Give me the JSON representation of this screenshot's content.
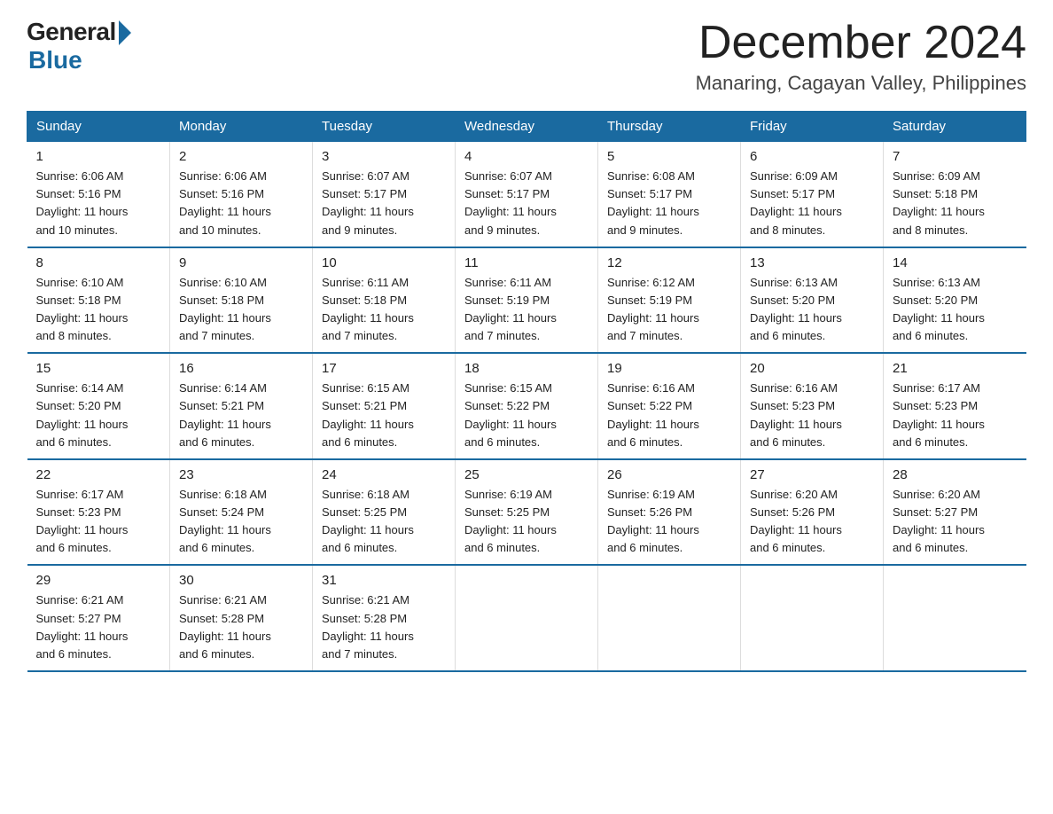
{
  "logo": {
    "general": "General",
    "blue": "Blue"
  },
  "header": {
    "month": "December 2024",
    "location": "Manaring, Cagayan Valley, Philippines"
  },
  "days_of_week": [
    "Sunday",
    "Monday",
    "Tuesday",
    "Wednesday",
    "Thursday",
    "Friday",
    "Saturday"
  ],
  "weeks": [
    [
      {
        "day": "1",
        "sunrise": "6:06 AM",
        "sunset": "5:16 PM",
        "daylight": "11 hours and 10 minutes."
      },
      {
        "day": "2",
        "sunrise": "6:06 AM",
        "sunset": "5:16 PM",
        "daylight": "11 hours and 10 minutes."
      },
      {
        "day": "3",
        "sunrise": "6:07 AM",
        "sunset": "5:17 PM",
        "daylight": "11 hours and 9 minutes."
      },
      {
        "day": "4",
        "sunrise": "6:07 AM",
        "sunset": "5:17 PM",
        "daylight": "11 hours and 9 minutes."
      },
      {
        "day": "5",
        "sunrise": "6:08 AM",
        "sunset": "5:17 PM",
        "daylight": "11 hours and 9 minutes."
      },
      {
        "day": "6",
        "sunrise": "6:09 AM",
        "sunset": "5:17 PM",
        "daylight": "11 hours and 8 minutes."
      },
      {
        "day": "7",
        "sunrise": "6:09 AM",
        "sunset": "5:18 PM",
        "daylight": "11 hours and 8 minutes."
      }
    ],
    [
      {
        "day": "8",
        "sunrise": "6:10 AM",
        "sunset": "5:18 PM",
        "daylight": "11 hours and 8 minutes."
      },
      {
        "day": "9",
        "sunrise": "6:10 AM",
        "sunset": "5:18 PM",
        "daylight": "11 hours and 7 minutes."
      },
      {
        "day": "10",
        "sunrise": "6:11 AM",
        "sunset": "5:18 PM",
        "daylight": "11 hours and 7 minutes."
      },
      {
        "day": "11",
        "sunrise": "6:11 AM",
        "sunset": "5:19 PM",
        "daylight": "11 hours and 7 minutes."
      },
      {
        "day": "12",
        "sunrise": "6:12 AM",
        "sunset": "5:19 PM",
        "daylight": "11 hours and 7 minutes."
      },
      {
        "day": "13",
        "sunrise": "6:13 AM",
        "sunset": "5:20 PM",
        "daylight": "11 hours and 6 minutes."
      },
      {
        "day": "14",
        "sunrise": "6:13 AM",
        "sunset": "5:20 PM",
        "daylight": "11 hours and 6 minutes."
      }
    ],
    [
      {
        "day": "15",
        "sunrise": "6:14 AM",
        "sunset": "5:20 PM",
        "daylight": "11 hours and 6 minutes."
      },
      {
        "day": "16",
        "sunrise": "6:14 AM",
        "sunset": "5:21 PM",
        "daylight": "11 hours and 6 minutes."
      },
      {
        "day": "17",
        "sunrise": "6:15 AM",
        "sunset": "5:21 PM",
        "daylight": "11 hours and 6 minutes."
      },
      {
        "day": "18",
        "sunrise": "6:15 AM",
        "sunset": "5:22 PM",
        "daylight": "11 hours and 6 minutes."
      },
      {
        "day": "19",
        "sunrise": "6:16 AM",
        "sunset": "5:22 PM",
        "daylight": "11 hours and 6 minutes."
      },
      {
        "day": "20",
        "sunrise": "6:16 AM",
        "sunset": "5:23 PM",
        "daylight": "11 hours and 6 minutes."
      },
      {
        "day": "21",
        "sunrise": "6:17 AM",
        "sunset": "5:23 PM",
        "daylight": "11 hours and 6 minutes."
      }
    ],
    [
      {
        "day": "22",
        "sunrise": "6:17 AM",
        "sunset": "5:23 PM",
        "daylight": "11 hours and 6 minutes."
      },
      {
        "day": "23",
        "sunrise": "6:18 AM",
        "sunset": "5:24 PM",
        "daylight": "11 hours and 6 minutes."
      },
      {
        "day": "24",
        "sunrise": "6:18 AM",
        "sunset": "5:25 PM",
        "daylight": "11 hours and 6 minutes."
      },
      {
        "day": "25",
        "sunrise": "6:19 AM",
        "sunset": "5:25 PM",
        "daylight": "11 hours and 6 minutes."
      },
      {
        "day": "26",
        "sunrise": "6:19 AM",
        "sunset": "5:26 PM",
        "daylight": "11 hours and 6 minutes."
      },
      {
        "day": "27",
        "sunrise": "6:20 AM",
        "sunset": "5:26 PM",
        "daylight": "11 hours and 6 minutes."
      },
      {
        "day": "28",
        "sunrise": "6:20 AM",
        "sunset": "5:27 PM",
        "daylight": "11 hours and 6 minutes."
      }
    ],
    [
      {
        "day": "29",
        "sunrise": "6:21 AM",
        "sunset": "5:27 PM",
        "daylight": "11 hours and 6 minutes."
      },
      {
        "day": "30",
        "sunrise": "6:21 AM",
        "sunset": "5:28 PM",
        "daylight": "11 hours and 6 minutes."
      },
      {
        "day": "31",
        "sunrise": "6:21 AM",
        "sunset": "5:28 PM",
        "daylight": "11 hours and 7 minutes."
      },
      null,
      null,
      null,
      null
    ]
  ],
  "labels": {
    "sunrise": "Sunrise:",
    "sunset": "Sunset:",
    "daylight": "Daylight:"
  }
}
